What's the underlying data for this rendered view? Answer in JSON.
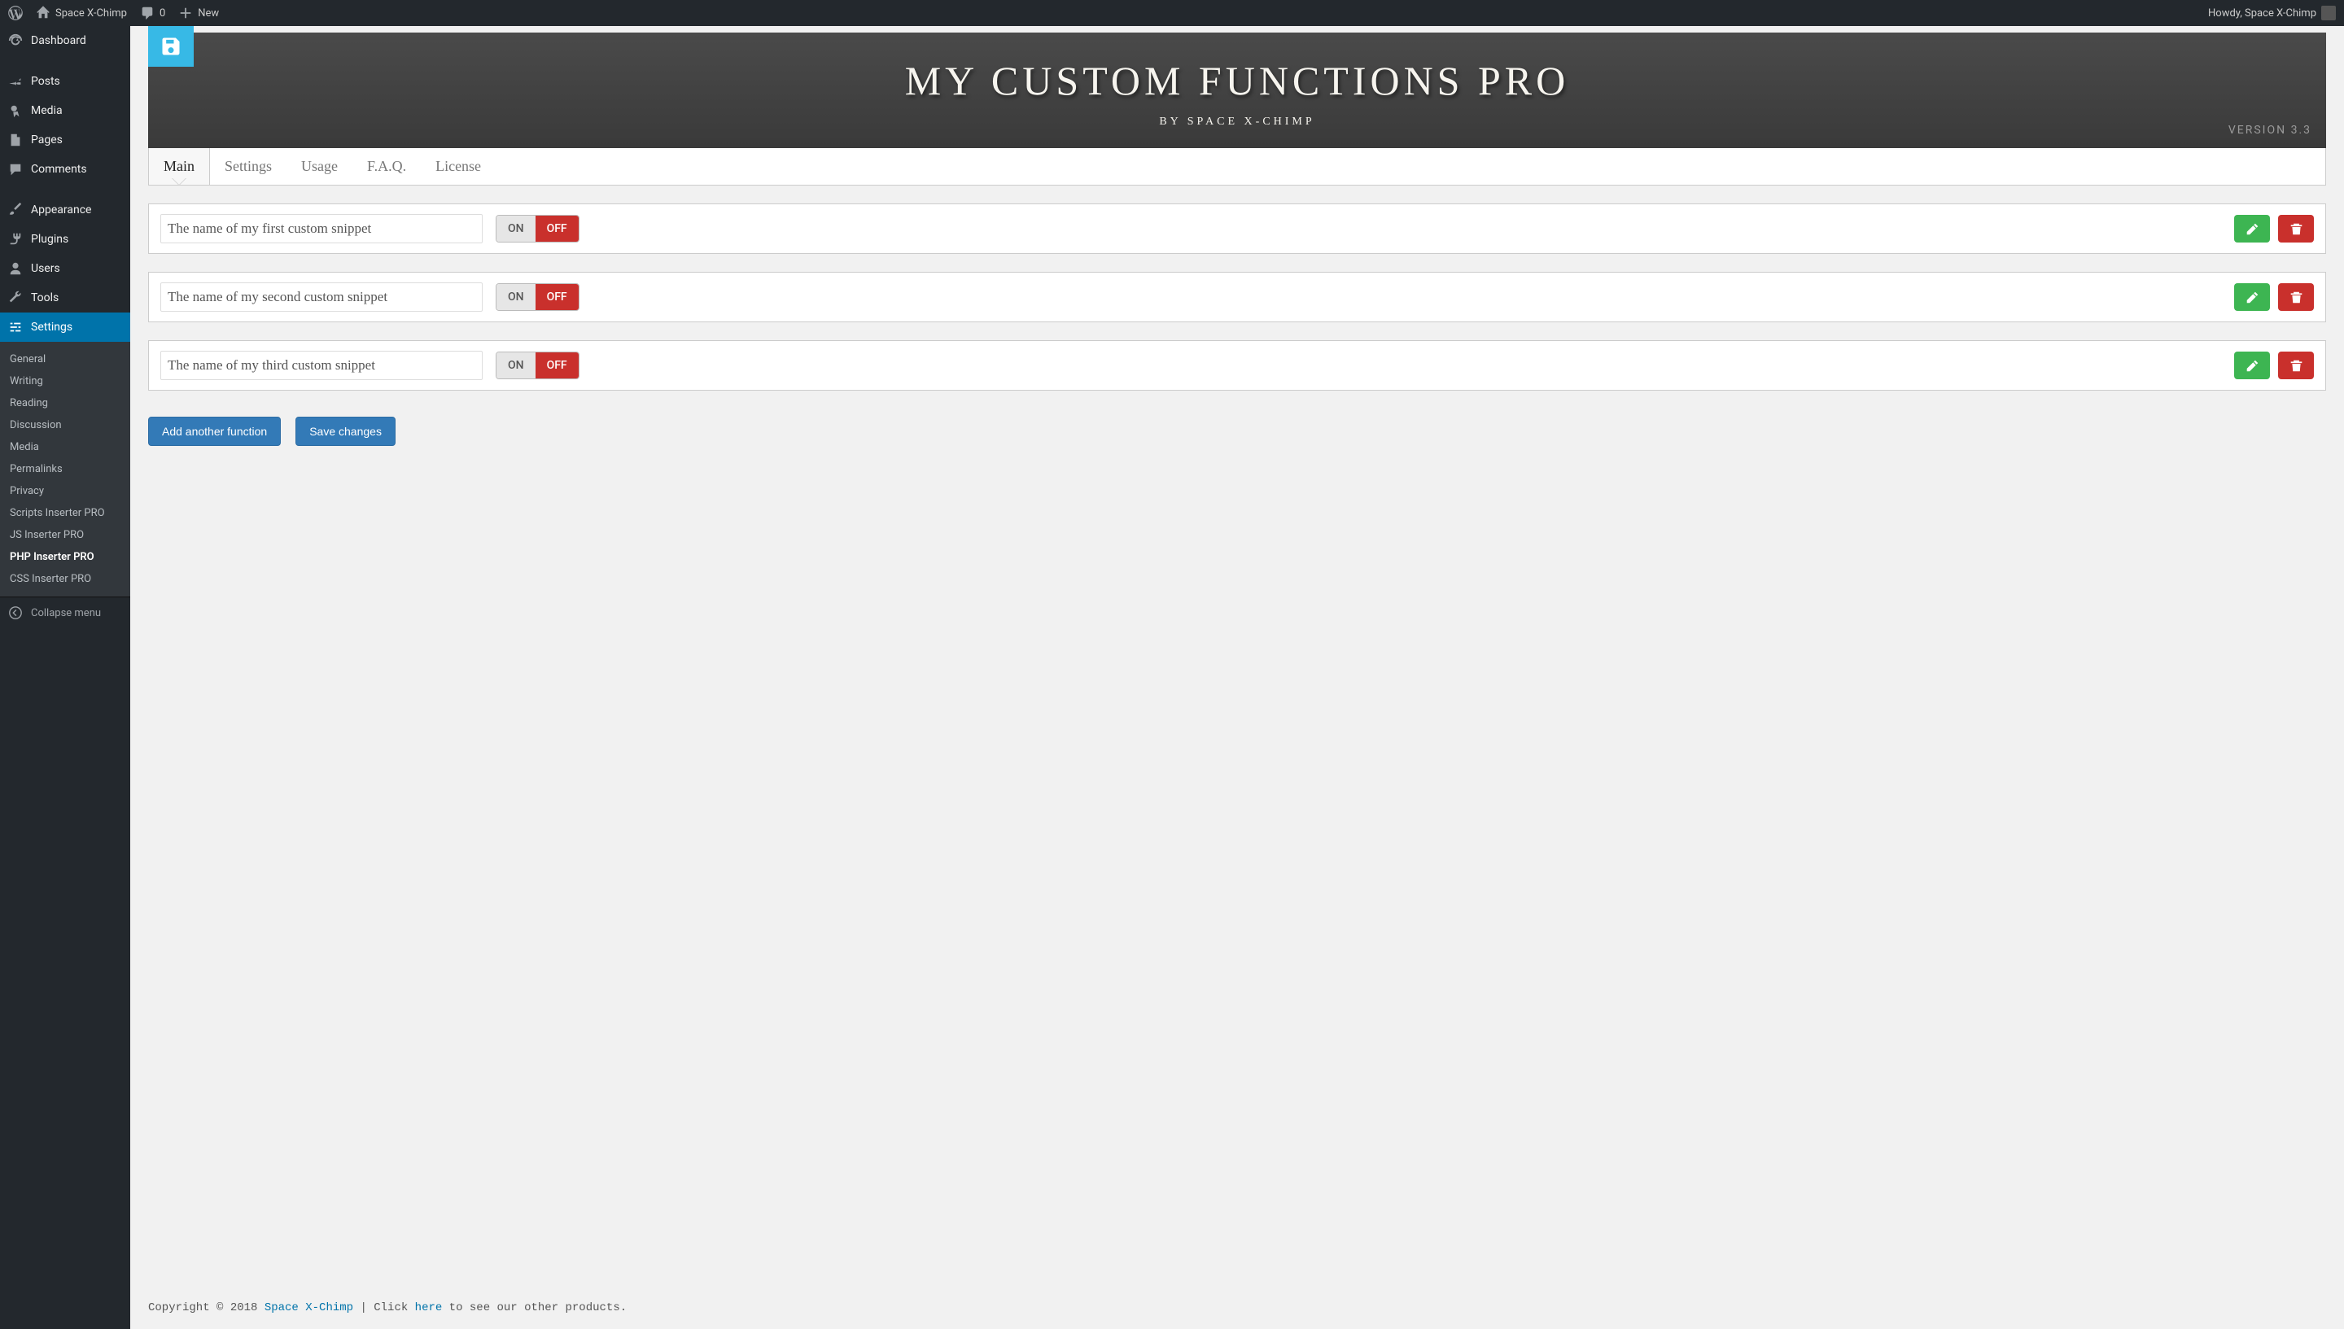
{
  "adminbar": {
    "site_name": "Space X-Chimp",
    "comment_count": "0",
    "new_label": "New",
    "howdy": "Howdy, Space X-Chimp"
  },
  "sidebar": {
    "items": [
      {
        "label": "Dashboard"
      },
      {
        "label": "Posts"
      },
      {
        "label": "Media"
      },
      {
        "label": "Pages"
      },
      {
        "label": "Comments"
      },
      {
        "label": "Appearance"
      },
      {
        "label": "Plugins"
      },
      {
        "label": "Users"
      },
      {
        "label": "Tools"
      },
      {
        "label": "Settings"
      }
    ],
    "submenu": [
      {
        "label": "General"
      },
      {
        "label": "Writing"
      },
      {
        "label": "Reading"
      },
      {
        "label": "Discussion"
      },
      {
        "label": "Media"
      },
      {
        "label": "Permalinks"
      },
      {
        "label": "Privacy"
      },
      {
        "label": "Scripts Inserter PRO"
      },
      {
        "label": "JS Inserter PRO"
      },
      {
        "label": "PHP Inserter PRO"
      },
      {
        "label": "CSS Inserter PRO"
      }
    ],
    "collapse": "Collapse menu"
  },
  "header": {
    "title": "MY CUSTOM FUNCTIONS PRO",
    "subtitle": "BY SPACE X-CHIMP",
    "version": "VERSION 3.3"
  },
  "tabs": [
    {
      "label": "Main"
    },
    {
      "label": "Settings"
    },
    {
      "label": "Usage"
    },
    {
      "label": "F.A.Q."
    },
    {
      "label": "License"
    }
  ],
  "toggle": {
    "on": "ON",
    "off": "OFF"
  },
  "snippets": [
    {
      "name": "The name of my first custom snippet"
    },
    {
      "name": "The name of my second custom snippet"
    },
    {
      "name": "The name of my third custom snippet"
    }
  ],
  "buttons": {
    "add": "Add another function",
    "save": "Save changes"
  },
  "footer": {
    "prefix": "Copyright © 2018 ",
    "brand": "Space X-Chimp",
    "mid": " | Click ",
    "link": "here",
    "suffix": " to see our other products."
  }
}
